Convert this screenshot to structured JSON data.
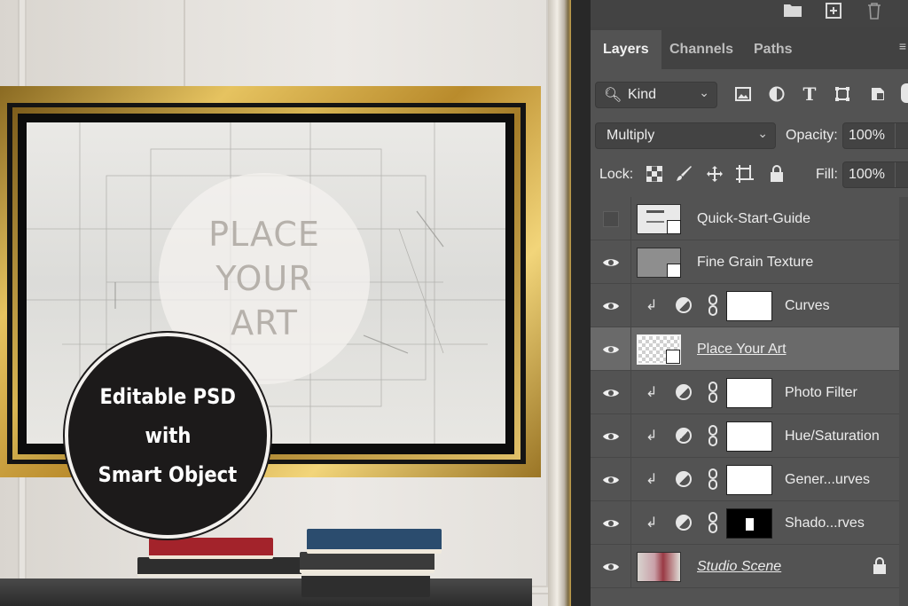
{
  "canvas": {
    "placeholder_lines": [
      "PLACE",
      "YOUR",
      "ART"
    ],
    "badge_lines": [
      "Editable PSD",
      "with",
      "Smart Object"
    ]
  },
  "panel": {
    "tabs": [
      {
        "label": "Layers",
        "active": true
      },
      {
        "label": "Channels",
        "active": false
      },
      {
        "label": "Paths",
        "active": false
      }
    ],
    "filter": {
      "label": "Kind",
      "icons": [
        "image-filter-icon",
        "adjustment-filter-icon",
        "type-filter-icon",
        "shape-filter-icon",
        "smart-object-filter-icon"
      ]
    },
    "blend_mode": "Multiply",
    "opacity_label": "Opacity:",
    "opacity_value": "100%",
    "lock_label": "Lock:",
    "fill_label": "Fill:",
    "fill_value": "100%",
    "layers": [
      {
        "name": "Quick-Start-Guide",
        "visible": false,
        "kind": "smart-object"
      },
      {
        "name": "Fine Grain Texture",
        "visible": true,
        "kind": "smart-object"
      },
      {
        "name": "Curves",
        "visible": true,
        "kind": "adjustment"
      },
      {
        "name": "Place Your Art",
        "visible": true,
        "kind": "smart-object",
        "selected": true
      },
      {
        "name": "Photo Filter",
        "visible": true,
        "kind": "adjustment"
      },
      {
        "name": "Hue/Saturation",
        "visible": true,
        "kind": "adjustment"
      },
      {
        "name": "Gener...urves",
        "visible": true,
        "kind": "adjustment"
      },
      {
        "name": "Shado...rves",
        "visible": true,
        "kind": "adjustment"
      },
      {
        "name": "Studio Scene",
        "visible": true,
        "kind": "background",
        "locked": true
      }
    ]
  },
  "colors": {
    "panel_bg": "#535353",
    "selected_row": "#6a6a6a",
    "gold": "#d4af4a",
    "badge": "#1c1a1a"
  }
}
